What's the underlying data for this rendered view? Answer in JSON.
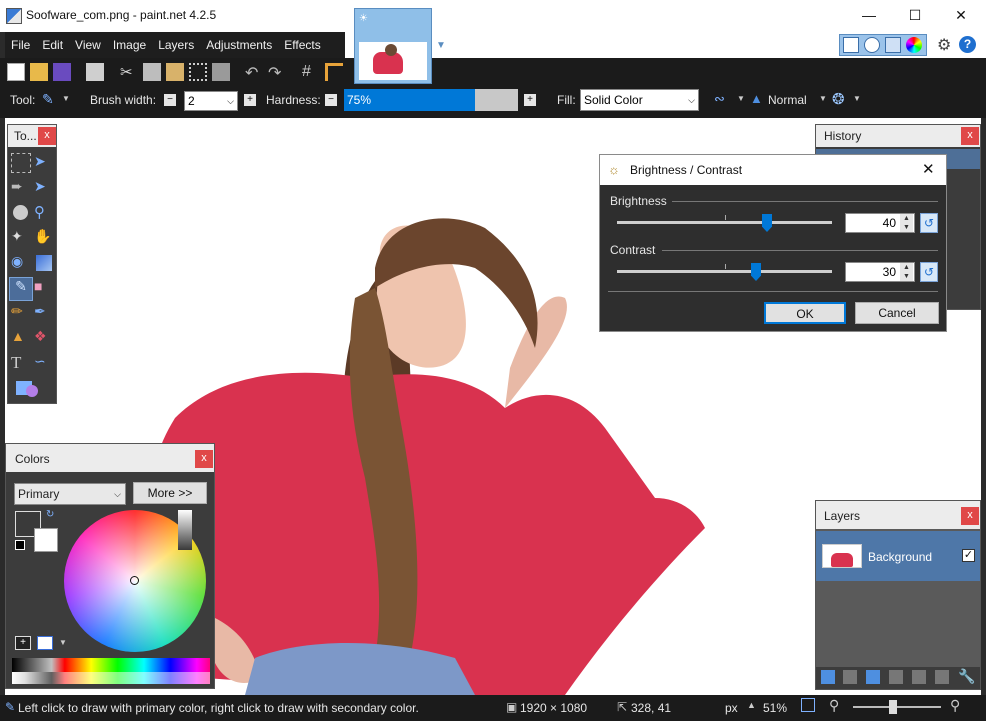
{
  "window": {
    "title": "Soofware_com.png - paint.net 4.2.5"
  },
  "menu": {
    "items": [
      "File",
      "Edit",
      "View",
      "Image",
      "Layers",
      "Adjustments",
      "Effects"
    ]
  },
  "toolbar2": {
    "tool_label": "Tool:",
    "brush_width_label": "Brush width:",
    "brush_width_value": "2",
    "hardness_label": "Hardness:",
    "hardness_value": "75%",
    "hardness_fraction": 0.75,
    "fill_label": "Fill:",
    "fill_value": "Solid Color",
    "blend_mode": "Normal"
  },
  "tools_panel": {
    "title": "To..."
  },
  "history_panel": {
    "title": "History"
  },
  "colors_panel": {
    "title": "Colors",
    "mode": "Primary",
    "more_button": "More >>"
  },
  "layers_panel": {
    "title": "Layers",
    "layer_name": "Background"
  },
  "dialog": {
    "title": "Brightness / Contrast",
    "brightness_label": "Brightness",
    "brightness_value": "40",
    "contrast_label": "Contrast",
    "contrast_value": "30",
    "ok": "OK",
    "cancel": "Cancel"
  },
  "status": {
    "hint": "Left click to draw with primary color, right click to draw with secondary color.",
    "image_size": "1920 × 1080",
    "cursor_pos": "328, 41",
    "units": "px",
    "zoom": "51%"
  },
  "colors": {
    "accent": "#0078d7",
    "close_red": "#e04848",
    "shirt": "#d9324f"
  }
}
